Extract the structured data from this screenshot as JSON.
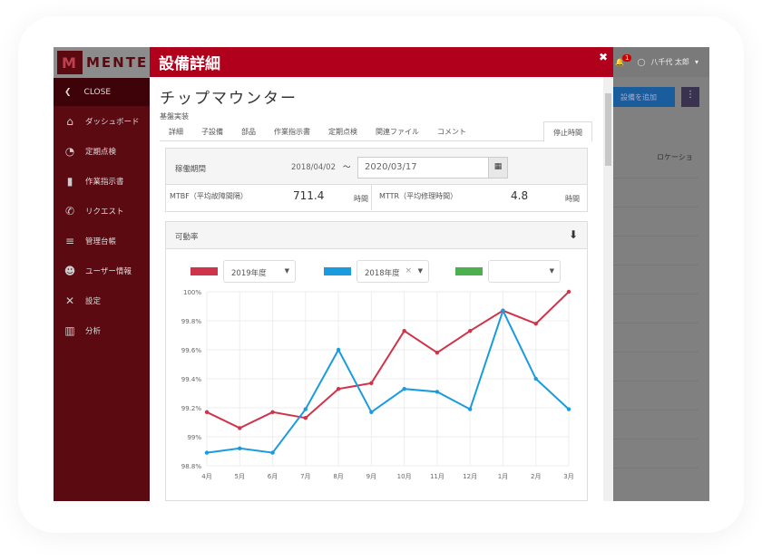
{
  "sidebar": {
    "logo": "MENTE",
    "close": "CLOSE",
    "items": [
      {
        "label": "ダッシュボード",
        "icon": "home-icon"
      },
      {
        "label": "定期点検",
        "icon": "gauge-icon"
      },
      {
        "label": "作業指示書",
        "icon": "clipboard-icon"
      },
      {
        "label": "リクエスト",
        "icon": "phone-icon"
      },
      {
        "label": "管理台帳",
        "icon": "database-icon"
      },
      {
        "label": "ユーザー情報",
        "icon": "users-icon"
      },
      {
        "label": "設定",
        "icon": "tools-icon"
      },
      {
        "label": "分析",
        "icon": "bar-chart-icon"
      }
    ]
  },
  "modal": {
    "header": "設備詳細",
    "title": "チップマウンター",
    "subtitle": "基盤実装",
    "tabs": [
      "詳細",
      "子設備",
      "部品",
      "作業指示書",
      "定期点検",
      "関連ファイル",
      "コメント",
      "停止時間"
    ],
    "period_label": "稼働期間",
    "date_from": "2018/04/02",
    "tilde": "〜",
    "date_to": "2020/03/17",
    "mtbf_label": "MTBF（平均故障間隔）",
    "mtbf_value": "711.4",
    "mttr_label": "MTTR（平均修理時間）",
    "mttr_value": "4.8",
    "unit": "時間",
    "chart_panel_title": "可動率"
  },
  "background": {
    "user": "八千代 太郎",
    "notif_count": "1",
    "add_button": "設備を追加",
    "column": "ロケーショ"
  },
  "chart_data": {
    "type": "line",
    "title": "可動率",
    "categories": [
      "4月",
      "5月",
      "6月",
      "7月",
      "8月",
      "9月",
      "10月",
      "11月",
      "12月",
      "1月",
      "2月",
      "3月"
    ],
    "yticks": [
      "100%",
      "99.8%",
      "99.6%",
      "99.4%",
      "99.2%",
      "99%",
      "98.8%"
    ],
    "ylim": [
      98.8,
      100
    ],
    "series": [
      {
        "name": "2019年度",
        "color": "#d0344a",
        "values": [
          99.17,
          99.06,
          99.17,
          99.13,
          99.33,
          99.37,
          99.73,
          99.58,
          99.73,
          99.87,
          99.78,
          100
        ]
      },
      {
        "name": "2018年度",
        "color": "#1a9be0",
        "values": [
          98.89,
          98.92,
          98.89,
          99.19,
          99.6,
          99.17,
          99.33,
          99.31,
          99.19,
          99.87,
          99.4,
          99.19
        ]
      },
      {
        "name": "",
        "color": "#4caf50",
        "values": []
      }
    ]
  }
}
